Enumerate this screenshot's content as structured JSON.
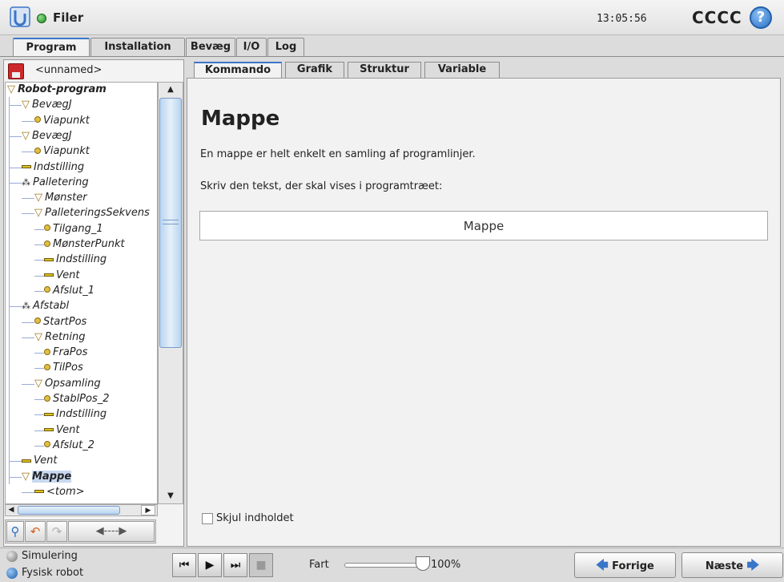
{
  "header": {
    "app_title": "Filer",
    "clock": "13:05:56",
    "robot_name": "CCCC",
    "help": "?"
  },
  "top_tabs": [
    {
      "label": "Program"
    },
    {
      "label": "Installation"
    },
    {
      "label": "Bevæg"
    },
    {
      "label": "I/O"
    },
    {
      "label": "Log"
    }
  ],
  "left": {
    "program_name": "<unnamed>"
  },
  "tree": [
    {
      "label": "Robot-program",
      "kind": "triangle",
      "bold": true
    },
    {
      "label": "BevægJ",
      "kind": "triangle"
    },
    {
      "label": "Viapunkt",
      "kind": "waypoint"
    },
    {
      "label": "BevægJ",
      "kind": "triangle"
    },
    {
      "label": "Viapunkt",
      "kind": "waypoint"
    },
    {
      "label": "Indstilling",
      "kind": "bar"
    },
    {
      "label": "Palletering",
      "kind": "pallet"
    },
    {
      "label": "Mønster",
      "kind": "triangle"
    },
    {
      "label": "PalleteringsSekvens",
      "kind": "triangle"
    },
    {
      "label": "Tilgang_1",
      "kind": "waypoint"
    },
    {
      "label": "MønsterPunkt",
      "kind": "waypoint"
    },
    {
      "label": "Indstilling",
      "kind": "bar"
    },
    {
      "label": "Vent",
      "kind": "bar"
    },
    {
      "label": "Afslut_1",
      "kind": "waypoint"
    },
    {
      "label": "Afstabl",
      "kind": "pallet"
    },
    {
      "label": "StartPos",
      "kind": "waypoint"
    },
    {
      "label": "Retning",
      "kind": "triangle"
    },
    {
      "label": "FraPos",
      "kind": "waypoint"
    },
    {
      "label": "TilPos",
      "kind": "waypoint"
    },
    {
      "label": "Opsamling",
      "kind": "triangle"
    },
    {
      "label": "StablPos_2",
      "kind": "waypoint"
    },
    {
      "label": "Indstilling",
      "kind": "bar"
    },
    {
      "label": "Vent",
      "kind": "bar"
    },
    {
      "label": "Afslut_2",
      "kind": "waypoint"
    },
    {
      "label": "Vent",
      "kind": "bar"
    },
    {
      "label": "Mappe",
      "kind": "triangle",
      "bold": true,
      "selected": true
    },
    {
      "label": "<tom>",
      "kind": "bar"
    }
  ],
  "sub_tabs": [
    {
      "label": "Kommando"
    },
    {
      "label": "Grafik"
    },
    {
      "label": "Struktur"
    },
    {
      "label": "Variable"
    }
  ],
  "content": {
    "heading": "Mappe",
    "description": "En mappe er helt enkelt en samling af programlinjer.",
    "prompt": "Skriv den tekst, der skal vises i programtræet:",
    "folder_name_value": "Mappe",
    "hide_checkbox_label": "Skjul indholdet",
    "hide_checked": false
  },
  "bottom": {
    "sim_label": "Simulering",
    "real_label": "Fysisk robot",
    "speed_label": "Fart",
    "speed_percent": "100%",
    "speed_value": 100,
    "prev_label": "Forrige",
    "next_label": "Næste"
  },
  "colors": {
    "accent": "#3a76c8",
    "tree_icon": "#e0c020",
    "sim_orb": "#808080",
    "real_orb": "#2a6fc4"
  }
}
